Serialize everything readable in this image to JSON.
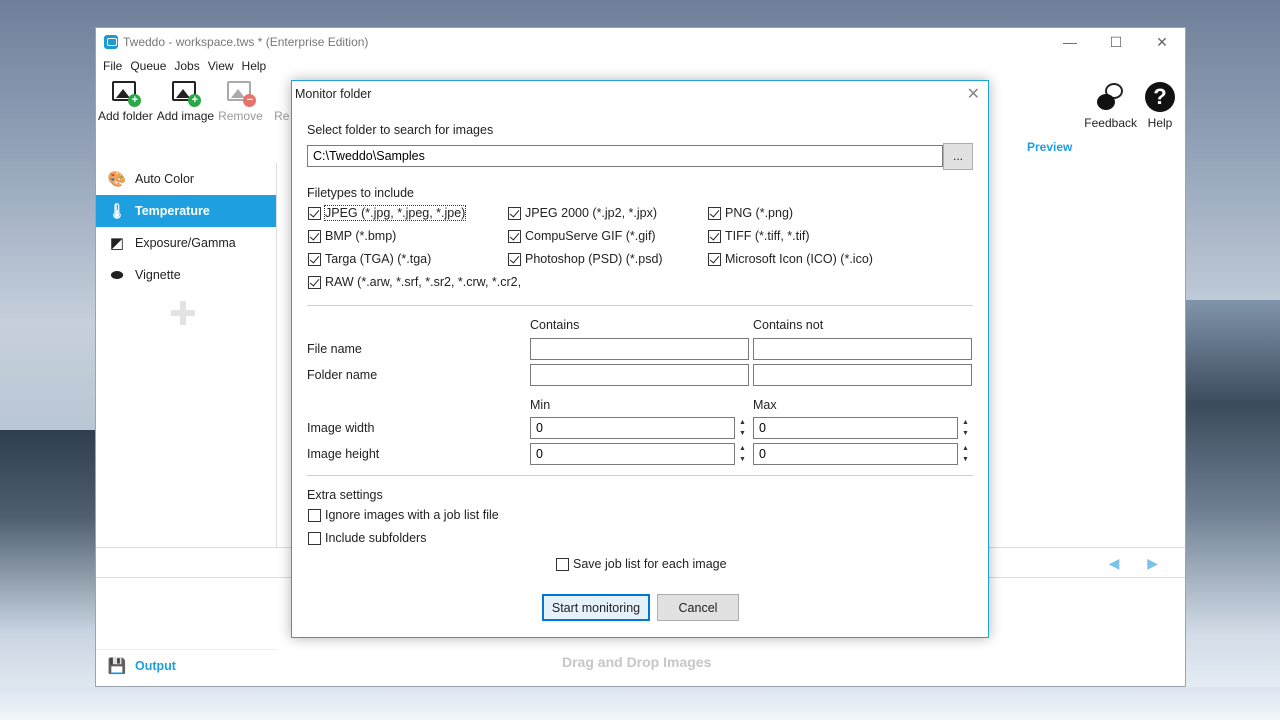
{
  "window": {
    "title": "Tweddo - workspace.tws * (Enterprise Edition)",
    "minimize": "—",
    "maximize": "☐",
    "close": "✕"
  },
  "menu": [
    "File",
    "Queue",
    "Jobs",
    "View",
    "Help"
  ],
  "toolbar": {
    "add_folder": "Add folder",
    "add_image": "Add image",
    "remove": "Remove",
    "partial": "Re",
    "feedback": "Feedback",
    "help": "Help"
  },
  "sidebar": {
    "items": [
      {
        "label": "Auto Color",
        "icon": "palette-icon"
      },
      {
        "label": "Temperature",
        "icon": "thermometer-icon"
      },
      {
        "label": "Exposure/Gamma",
        "icon": "exposure-icon"
      },
      {
        "label": "Vignette",
        "icon": "vignette-icon"
      }
    ],
    "output": "Output"
  },
  "main": {
    "preview": "Preview",
    "drag_drop": "Drag and Drop Images",
    "nav": "◀ ▶"
  },
  "dialog": {
    "title": "Monitor folder",
    "select_label": "Select folder to search for images",
    "folder_path": "C:\\Tweddo\\Samples",
    "browse": "...",
    "filetypes_label": "Filetypes to include",
    "filetypes": [
      {
        "label": "JPEG (*.jpg, *.jpeg, *.jpe)",
        "checked": true
      },
      {
        "label": "JPEG 2000 (*.jp2, *.jpx)",
        "checked": true
      },
      {
        "label": "PNG (*.png)",
        "checked": true
      },
      {
        "label": "BMP (*.bmp)",
        "checked": true
      },
      {
        "label": "CompuServe GIF (*.gif)",
        "checked": true
      },
      {
        "label": "TIFF (*.tiff, *.tif)",
        "checked": true
      },
      {
        "label": "Targa (TGA) (*.tga)",
        "checked": true
      },
      {
        "label": "Photoshop (PSD) (*.psd)",
        "checked": true
      },
      {
        "label": "Microsoft Icon (ICO) (*.ico)",
        "checked": true
      },
      {
        "label": "RAW (*.arw, *.srf, *.sr2, *.crw, *.cr2,",
        "checked": true
      }
    ],
    "contains": "Contains",
    "contains_not": "Contains not",
    "file_name": "File name",
    "folder_name": "Folder name",
    "file_name_contains": "",
    "file_name_contains_not": "",
    "folder_name_contains": "",
    "folder_name_contains_not": "",
    "min": "Min",
    "max": "Max",
    "image_width": "Image width",
    "image_height": "Image height",
    "width_min": "0",
    "width_max": "0",
    "height_min": "0",
    "height_max": "0",
    "extra_label": "Extra settings",
    "ignore_joblist": {
      "label": "Ignore images with a job list file",
      "checked": false
    },
    "include_subfolders": {
      "label": "Include subfolders",
      "checked": false
    },
    "save_joblist": {
      "label": "Save job list for each image",
      "checked": false
    },
    "start": "Start monitoring",
    "cancel": "Cancel",
    "close": "✕"
  },
  "colors": {
    "accent": "#1e9fe0",
    "primary_button_border": "#0078d7"
  }
}
